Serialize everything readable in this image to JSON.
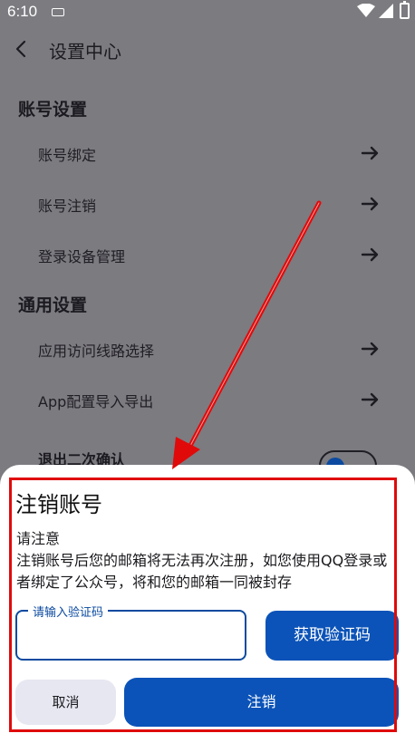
{
  "status_bar": {
    "time": "6:10"
  },
  "header": {
    "title": "设置中心"
  },
  "sections": [
    {
      "title": "账号设置",
      "items": [
        {
          "label": "账号绑定"
        },
        {
          "label": "账号注销"
        },
        {
          "label": "登录设备管理"
        }
      ]
    },
    {
      "title": "通用设置",
      "items": [
        {
          "label": "应用访问线路选择"
        },
        {
          "label": "App配置导入导出"
        },
        {
          "label": "退出二次确认",
          "toggle_on": true
        }
      ]
    }
  ],
  "dialog": {
    "title": "注销账号",
    "notice_title": "请注意",
    "notice_body": "注销账号后您的邮箱将无法再次注册，如您使用QQ登录或者绑定了公众号，将和您的邮箱一同被封存",
    "code_field": {
      "label": "请输入验证码",
      "value": ""
    },
    "get_code_label": "获取验证码",
    "cancel_label": "取消",
    "confirm_label": "注销"
  },
  "colors": {
    "primary": "#0b53b8",
    "overlay": "#7c7b80",
    "highlight": "#e00a0a"
  }
}
